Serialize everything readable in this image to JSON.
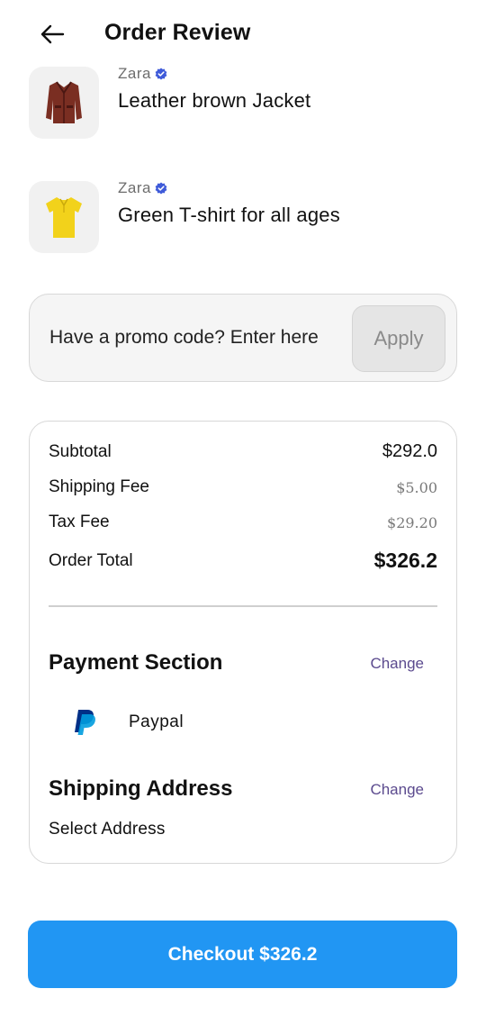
{
  "header": {
    "title": "Order Review",
    "back_icon": "arrow-left-icon"
  },
  "products": [
    {
      "brand": "Zara",
      "verified_icon": "verified-badge-icon",
      "name": "Leather brown Jacket",
      "image": "leather-jacket-image"
    },
    {
      "brand": "Zara",
      "verified_icon": "verified-badge-icon",
      "name": "Green T-shirt for all ages",
      "image": "yellow-tshirt-image"
    }
  ],
  "promo": {
    "placeholder": "Have a promo code? Enter here",
    "apply_label": "Apply"
  },
  "summary": {
    "subtotal_label": "Subtotal",
    "subtotal_value": "$292.0",
    "shipping_label": "Shipping Fee",
    "shipping_value": "$5.00",
    "tax_label": "Tax Fee",
    "tax_value": "$29.20",
    "total_label": "Order Total",
    "total_value": "$326.2"
  },
  "payment": {
    "title": "Payment Section",
    "change_label": "Change",
    "method": "Paypal",
    "method_icon": "paypal-icon"
  },
  "shipping": {
    "title": "Shipping Address",
    "change_label": "Change",
    "address": "Select Address"
  },
  "checkout": {
    "label": "Checkout $326.2"
  },
  "colors": {
    "accent": "#2196f3",
    "link": "#5b4a8e",
    "verified": "#3f5bd9"
  }
}
